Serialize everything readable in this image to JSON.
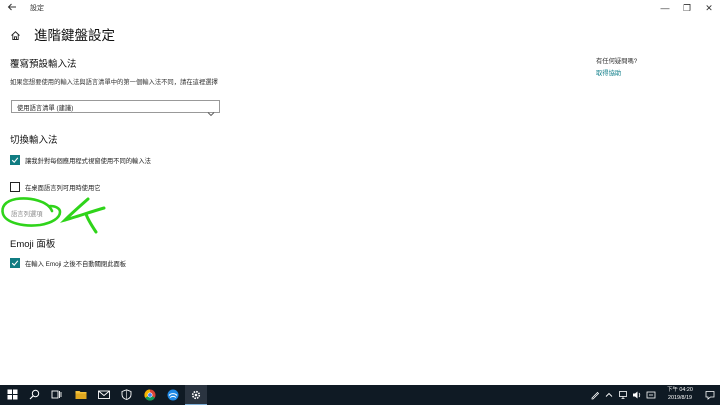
{
  "window": {
    "title": "設定",
    "minimize": "—",
    "maximize": "❐",
    "close": "✕"
  },
  "header": {
    "title": "進階鍵盤設定"
  },
  "override_section": {
    "title": "覆寫預設輸入法",
    "description": "如果您想要使用的輸入法與語言清單中的第一個輸入法不同，請在這裡選擇",
    "dropdown_value": "使用語言清單 (建議)"
  },
  "switch_section": {
    "title": "切換輸入法",
    "option1": {
      "label": "讓我針對每個應用程式視窗使用不同的輸入法",
      "checked": true
    },
    "option2": {
      "label": "在桌面語言列可用時使用它",
      "checked": false
    },
    "language_bar_link": "語言列選項"
  },
  "emoji_section": {
    "title": "Emoji 面板",
    "option": {
      "label": "在輸入 Emoji 之後不自動關閉此面板",
      "checked": true
    }
  },
  "sidebar": {
    "title": "有任何疑問嗎?",
    "help_link": "取得協助"
  },
  "taskbar": {
    "time": "下午 04:20",
    "date": "2019/8/19"
  },
  "colors": {
    "accent": "#107c82",
    "annotation": "#2fd41a",
    "taskbar": "#0f1a24"
  }
}
